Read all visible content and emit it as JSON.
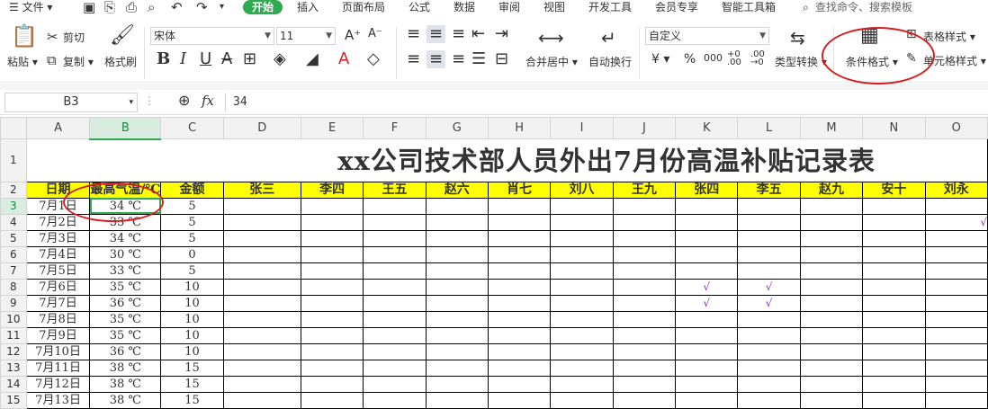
{
  "menu": {
    "file": "文件",
    "tabs": [
      "开始",
      "插入",
      "页面布局",
      "公式",
      "数据",
      "审阅",
      "视图",
      "开发工具",
      "会员专享",
      "智能工具箱"
    ],
    "search": "查找命令、搜索模板"
  },
  "ribbon": {
    "paste": "粘贴",
    "cut": "剪切",
    "copy": "复制",
    "format_painter": "格式刷",
    "font_name": "宋体",
    "font_size": "11",
    "merge_center": "合并居中",
    "wrap_text": "自动换行",
    "number_format": "自定义",
    "convert_type": "类型转换",
    "conditional_format": "条件格式",
    "table_style": "表格样式",
    "cell_style": "单元格样式"
  },
  "formula_bar": {
    "name_box": "B3",
    "formula": "34"
  },
  "sheet": {
    "columns": [
      "A",
      "B",
      "C",
      "D",
      "E",
      "F",
      "G",
      "H",
      "I",
      "J",
      "K",
      "L",
      "M",
      "N",
      "O"
    ],
    "title": "xx公司技术部人员外出7月份高温补贴记录表",
    "headers": [
      "日期",
      "最高气温/℃",
      "金额",
      "张三",
      "李四",
      "王五",
      "赵六",
      "肖七",
      "刘八",
      "王九",
      "张四",
      "李五",
      "赵九",
      "安十",
      "刘永"
    ],
    "rows": [
      {
        "r": "3",
        "date": "7月1日",
        "temp": "34 ℃",
        "amount": "5"
      },
      {
        "r": "4",
        "date": "7月2日",
        "temp": "33 ℃",
        "amount": "5"
      },
      {
        "r": "5",
        "date": "7月3日",
        "temp": "34 ℃",
        "amount": "5"
      },
      {
        "r": "6",
        "date": "7月4日",
        "temp": "30 ℃",
        "amount": "0"
      },
      {
        "r": "7",
        "date": "7月5日",
        "temp": "33 ℃",
        "amount": "5"
      },
      {
        "r": "8",
        "date": "7月6日",
        "temp": "35 ℃",
        "amount": "10"
      },
      {
        "r": "9",
        "date": "7月7日",
        "temp": "36 ℃",
        "amount": "10"
      },
      {
        "r": "10",
        "date": "7月8日",
        "temp": "35 ℃",
        "amount": "10"
      },
      {
        "r": "11",
        "date": "7月9日",
        "temp": "35 ℃",
        "amount": "10"
      },
      {
        "r": "12",
        "date": "7月10日",
        "temp": "36 ℃",
        "amount": "10"
      },
      {
        "r": "13",
        "date": "7月11日",
        "temp": "38 ℃",
        "amount": "15"
      },
      {
        "r": "14",
        "date": "7月12日",
        "temp": "38 ℃",
        "amount": "15"
      },
      {
        "r": "15",
        "date": "7月13日",
        "temp": "38 ℃",
        "amount": "15"
      }
    ],
    "checkmark": "√"
  },
  "colors": {
    "accent": "#2faa50",
    "header_fill": "#ffff00",
    "annotation": "#d81e1e",
    "check": "#8b2fc9"
  }
}
